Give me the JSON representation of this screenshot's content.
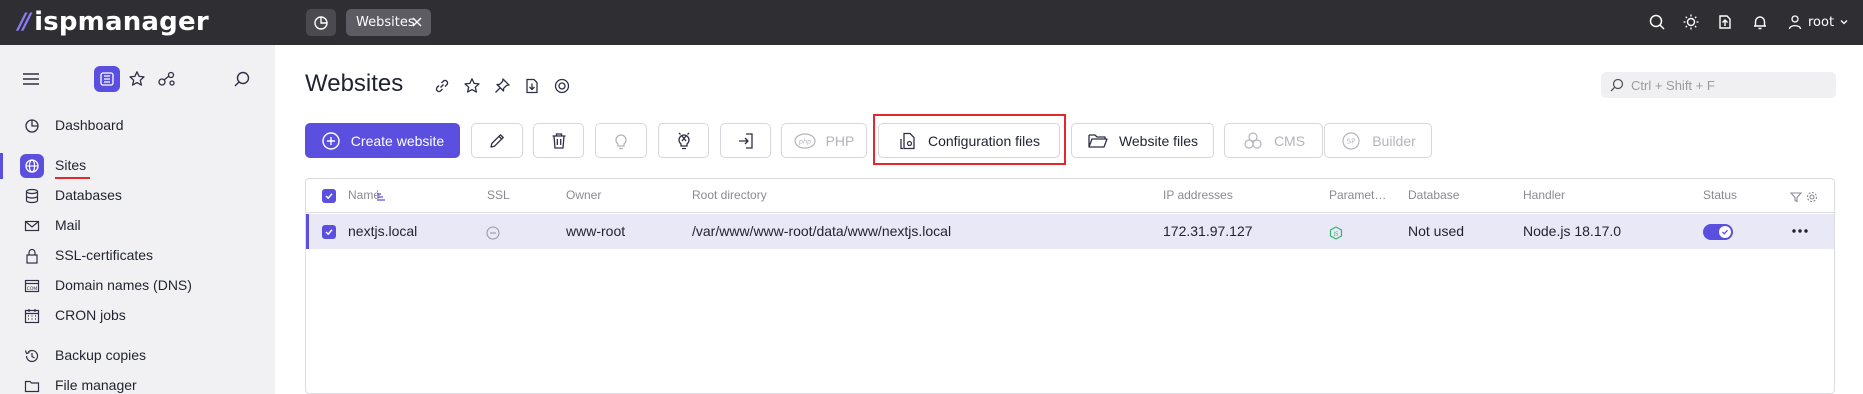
{
  "app": {
    "logo_text": "ispmanager"
  },
  "topbar": {
    "tab_label": "Websites",
    "user_label": "root",
    "icons": [
      "search-icon",
      "theme-sun-icon",
      "upload-icon",
      "bell-icon",
      "user-icon"
    ]
  },
  "sidebar": {
    "items": [
      {
        "label": "Dashboard",
        "icon": "dashboard-icon"
      },
      {
        "label": "Sites",
        "icon": "globe-icon",
        "active": true
      },
      {
        "label": "Databases",
        "icon": "database-icon"
      },
      {
        "label": "Mail",
        "icon": "mail-icon"
      },
      {
        "label": "SSL-certificates",
        "icon": "lock-icon"
      },
      {
        "label": "Domain names (DNS)",
        "icon": "dns-icon"
      },
      {
        "label": "CRON jobs",
        "icon": "calendar-icon"
      },
      {
        "label": "Backup copies",
        "icon": "backup-icon"
      },
      {
        "label": "File manager",
        "icon": "folder-icon"
      }
    ]
  },
  "main": {
    "title": "Websites",
    "search": {
      "placeholder": "Ctrl + Shift + F"
    },
    "actions": {
      "create": "Create website",
      "php": "PHP",
      "config_files": "Configuration files",
      "website_files": "Website files",
      "cms": "CMS",
      "builder": "Builder"
    }
  },
  "table": {
    "columns": {
      "name": "Name",
      "ssl": "SSL",
      "owner": "Owner",
      "root": "Root directory",
      "ip": "IP addresses",
      "params": "Paramet…",
      "database": "Database",
      "handler": "Handler",
      "status": "Status"
    },
    "rows": [
      {
        "name": "nextjs.local",
        "owner": "www-root",
        "root": "/var/www/www-root/data/www/nextjs.local",
        "ip": "172.31.97.127",
        "database": "Not used",
        "handler": "Node.js 18.17.0",
        "status_on": true
      }
    ]
  },
  "colors": {
    "accent": "#5b4fe0",
    "topbar": "#2f2f33",
    "highlight": "#e2282c"
  }
}
